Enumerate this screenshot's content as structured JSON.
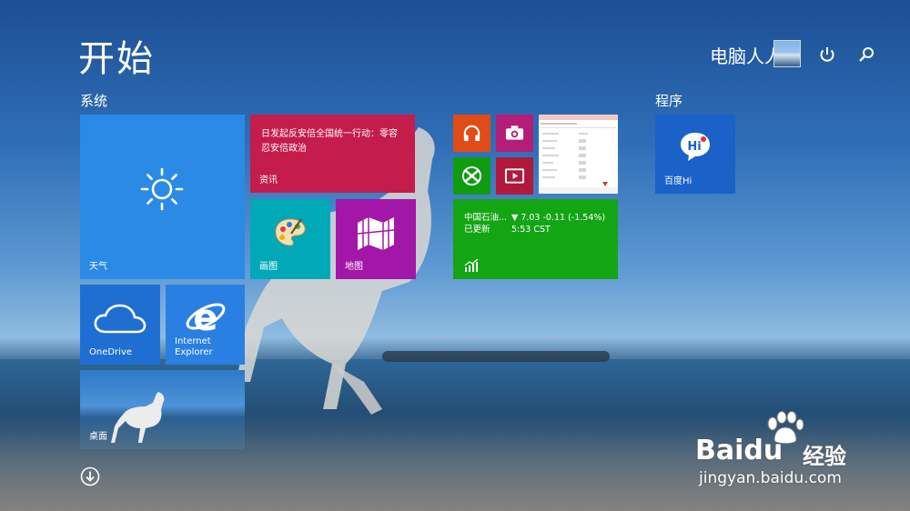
{
  "start": {
    "title": "开始"
  },
  "header": {
    "user_name": "电脑人人有"
  },
  "groups": {
    "system": "系统",
    "programs": "程序"
  },
  "tiles": {
    "weather": {
      "label": "天气"
    },
    "news": {
      "headline": "日发起反安倍全国统一行动：零容忍安倍政治",
      "label": "资讯"
    },
    "paint": {
      "label": "画图"
    },
    "maps": {
      "label": "地图"
    },
    "finance": {
      "name": "中国石油...",
      "status": "已更新",
      "quote": "▼ 7.03  -0.11 (-1.54%)",
      "time": "5:53 CST"
    },
    "onedrive": {
      "label": "OneDrive"
    },
    "ie": {
      "label_line1": "Internet",
      "label_line2": "Explorer"
    },
    "desktop": {
      "label": "桌面"
    },
    "baiduhi": {
      "label": "百度Hi"
    }
  },
  "watermark": {
    "brand": "Bai",
    "brand2": "du",
    "cn": "经验",
    "url": "jingyan.baidu.com"
  },
  "colors": {
    "weather": "#2a8ae6",
    "news": "#c41c4b",
    "paint": "#00a8b8",
    "maps": "#a217a8",
    "music": "#e14b18",
    "camera": "#b41e78",
    "games": "#109b10",
    "video": "#b0183c",
    "finance": "#14a514",
    "onedrive": "#1f6fd3",
    "ie": "#2a7fe2",
    "baiduhi": "#1a62c8"
  }
}
